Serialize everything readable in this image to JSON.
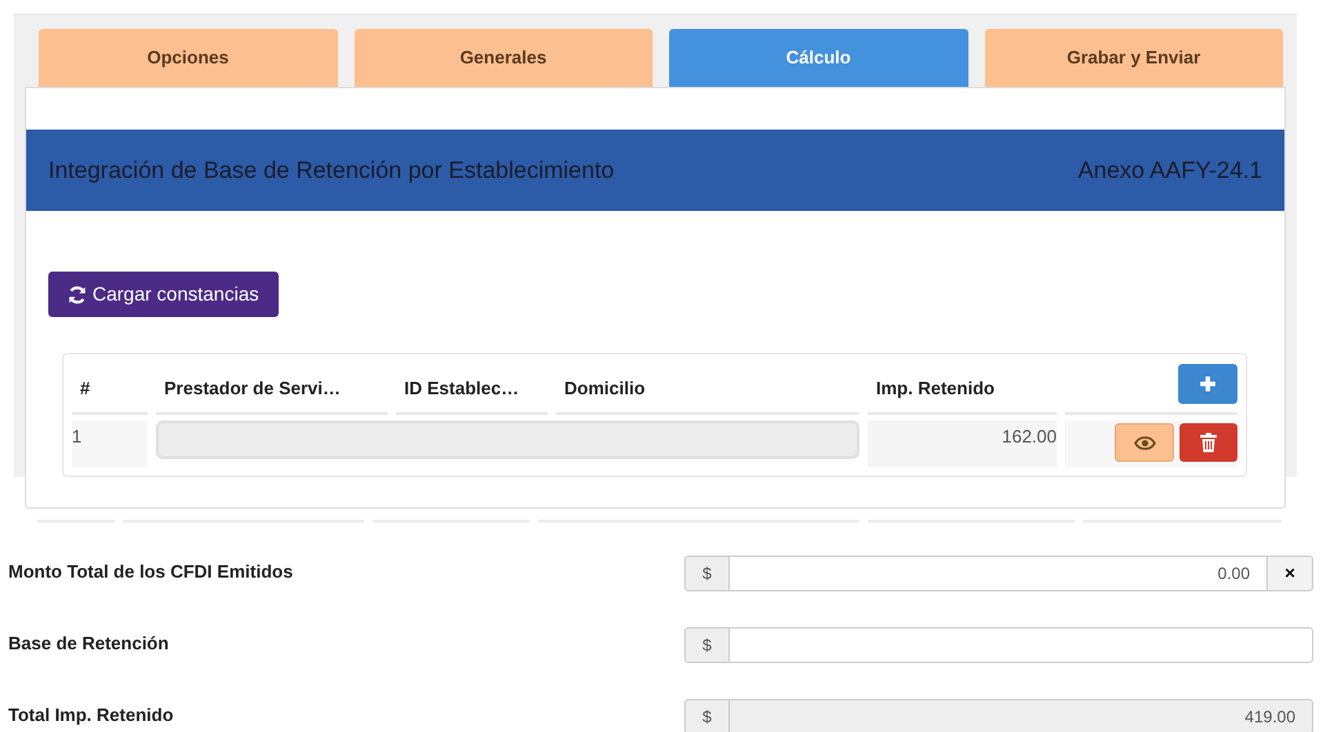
{
  "tabs": [
    {
      "label": "Opciones",
      "selected": false
    },
    {
      "label": "Generales",
      "selected": false
    },
    {
      "label": "Cálculo",
      "selected": true
    },
    {
      "label": "Grabar y Enviar",
      "selected": false
    }
  ],
  "panel": {
    "title": "Integración de Base de Retención por Establecimiento",
    "annex": "Anexo AAFY-24.1"
  },
  "load_button": "Cargar constancias",
  "table": {
    "columns": [
      "#",
      "Prestador de Servi…",
      "ID Establec…",
      "Domicilio",
      "Imp. Retenido"
    ],
    "rows": [
      {
        "number": "1",
        "amount": "162.00"
      }
    ]
  },
  "fields": [
    {
      "label": "Monto Total de los CFDI Emitidos",
      "prefix": "$",
      "value": "0.00",
      "disabled": false,
      "clear": "×"
    },
    {
      "label": "Base de Retención",
      "prefix": "$",
      "disabled": false
    },
    {
      "label": "Total Imp. Retenido",
      "prefix": "$",
      "value": "419.00",
      "disabled": true
    }
  ]
}
